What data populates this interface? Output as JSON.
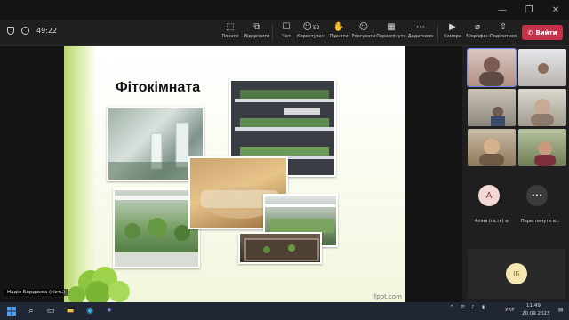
{
  "window": {
    "minimize_icon": "minimize-icon",
    "maximize_icon": "maximize-icon",
    "close_icon": "close-icon"
  },
  "meeting": {
    "elapsed": "49:22"
  },
  "toolbar": {
    "buttons": [
      {
        "label": "Почати",
        "icon": "record-icon"
      },
      {
        "label": "Відкріпити",
        "icon": "unpin-icon"
      },
      {
        "label": "Чат",
        "icon": "chat-icon"
      },
      {
        "label": "Користувачі",
        "icon": "people-icon",
        "count": "52"
      },
      {
        "label": "Підняти",
        "icon": "raise-hand-icon"
      },
      {
        "label": "Реагувати",
        "icon": "react-icon"
      },
      {
        "label": "Пересмінути",
        "icon": "view-icon"
      },
      {
        "label": "Додатково",
        "icon": "more-icon"
      },
      {
        "label": "Камера",
        "icon": "camera-off-icon"
      },
      {
        "label": "Мікрофон",
        "icon": "mic-off-icon"
      },
      {
        "label": "Поділитися",
        "icon": "share-icon"
      }
    ],
    "leave_label": "Вийти",
    "leave_color": "#c4314b"
  },
  "slide": {
    "title": "Фітокімната",
    "footer": "fppt.com"
  },
  "presenter": {
    "name": "Надія Бордюжа (гість)"
  },
  "participants": {
    "tiles": [
      {
        "name": "",
        "active": true
      },
      {
        "name": ""
      },
      {
        "name": ""
      },
      {
        "name": ""
      },
      {
        "name": ""
      },
      {
        "name": ""
      }
    ],
    "avatar_a": {
      "initial": "A",
      "name": "Аліна (гість)",
      "color": "#f3d9d5"
    },
    "overflow": {
      "glyph": "•••",
      "name": "Переглянути в..."
    },
    "bottom": {
      "initials": "ІБ",
      "color": "#f6e8b5"
    }
  },
  "taskbar": {
    "language": "УКР",
    "time": "11:49",
    "date": "20.09.2023"
  }
}
